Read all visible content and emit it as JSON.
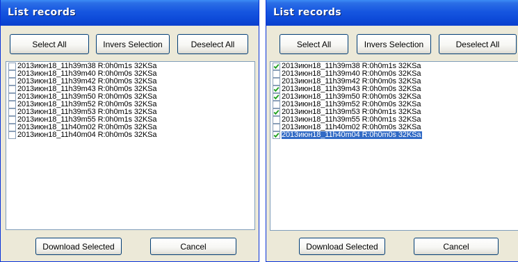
{
  "windows": [
    {
      "title": "List records",
      "buttons": {
        "select_all": "Select All",
        "invert": "Invers Selection",
        "deselect_all": "Deselect All",
        "download": "Download Selected",
        "cancel": "Cancel"
      },
      "records": [
        {
          "label": "2013июн18_11h39m38 R:0h0m1s 32KSa",
          "checked": false,
          "selected": false
        },
        {
          "label": "2013июн18_11h39m40 R:0h0m0s 32KSa",
          "checked": false,
          "selected": false
        },
        {
          "label": "2013июн18_11h39m42 R:0h0m0s 32KSa",
          "checked": false,
          "selected": false
        },
        {
          "label": "2013июн18_11h39m43 R:0h0m0s 32KSa",
          "checked": false,
          "selected": false
        },
        {
          "label": "2013июн18_11h39m50 R:0h0m0s 32KSa",
          "checked": false,
          "selected": false
        },
        {
          "label": "2013июн18_11h39m52 R:0h0m0s 32KSa",
          "checked": false,
          "selected": false
        },
        {
          "label": "2013июн18_11h39m53 R:0h0m1s 32KSa",
          "checked": false,
          "selected": false
        },
        {
          "label": "2013июн18_11h39m55 R:0h0m1s 32KSa",
          "checked": false,
          "selected": false
        },
        {
          "label": "2013июн18_11h40m02 R:0h0m0s 32KSa",
          "checked": false,
          "selected": false
        },
        {
          "label": "2013июн18_11h40m04 R:0h0m0s 32KSa",
          "checked": false,
          "selected": false
        }
      ]
    },
    {
      "title": "List records",
      "buttons": {
        "select_all": "Select All",
        "invert": "Invers Selection",
        "deselect_all": "Deselect All",
        "download": "Download Selected",
        "cancel": "Cancel"
      },
      "records": [
        {
          "label": "2013июн18_11h39m38 R:0h0m1s 32KSa",
          "checked": true,
          "selected": false
        },
        {
          "label": "2013июн18_11h39m40 R:0h0m0s 32KSa",
          "checked": false,
          "selected": false
        },
        {
          "label": "2013июн18_11h39m42 R:0h0m0s 32KSa",
          "checked": false,
          "selected": false
        },
        {
          "label": "2013июн18_11h39m43 R:0h0m0s 32KSa",
          "checked": true,
          "selected": false
        },
        {
          "label": "2013июн18_11h39m50 R:0h0m0s 32KSa",
          "checked": true,
          "selected": false
        },
        {
          "label": "2013июн18_11h39m52 R:0h0m0s 32KSa",
          "checked": false,
          "selected": false
        },
        {
          "label": "2013июн18_11h39m53 R:0h0m1s 32KSa",
          "checked": true,
          "selected": false
        },
        {
          "label": "2013июн18_11h39m55 R:0h0m1s 32KSa",
          "checked": false,
          "selected": false
        },
        {
          "label": "2013июн18_11h40m02 R:0h0m0s 32KSa",
          "checked": false,
          "selected": false
        },
        {
          "label": "2013июн18_11h40m04 R:0h0m0s 32KSa",
          "checked": true,
          "selected": true
        }
      ]
    }
  ],
  "colors": {
    "titlebar": "#0d4ad8",
    "window_face": "#ece9d8",
    "selection": "#316ac5",
    "check": "#21a121"
  },
  "icons": {
    "checkmark": "checkmark-icon"
  }
}
